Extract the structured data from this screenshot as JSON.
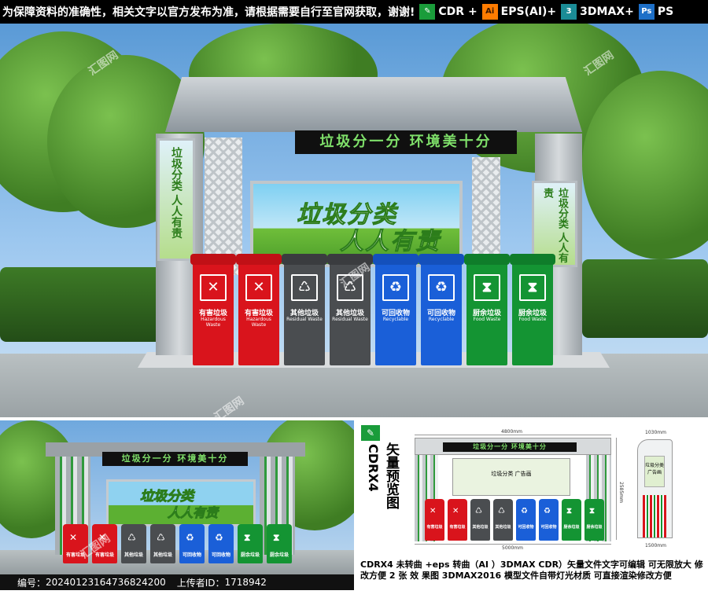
{
  "notice": "为保障资料的准确性，相关文字以官方发布为准，请根据需要自行至官网获取，谢谢!",
  "formats": [
    "CDR +",
    "EPS(AI)+",
    "3DMAX+",
    "PS"
  ],
  "format_icons": [
    "cdr-logo-icon",
    "ai-logo-icon",
    "3dmax-logo-icon",
    "ps-logo-icon"
  ],
  "sign_text": "垃圾分一分  环境美十分",
  "billboard_line1": "垃圾分类",
  "billboard_line2": "人人有责",
  "side_panel_text": "垃圾分类 人人有责",
  "bins": [
    {
      "color": "red",
      "label": "有害垃圾",
      "sub": "Hazardous Waste",
      "symbol": "✕"
    },
    {
      "color": "red",
      "label": "有害垃圾",
      "sub": "Hazardous Waste",
      "symbol": "✕"
    },
    {
      "color": "grey",
      "label": "其他垃圾",
      "sub": "Residual Waste",
      "symbol": "♺"
    },
    {
      "color": "grey",
      "label": "其他垃圾",
      "sub": "Residual Waste",
      "symbol": "♺"
    },
    {
      "color": "blue",
      "label": "可回收物",
      "sub": "Recyclable",
      "symbol": "♻"
    },
    {
      "color": "blue",
      "label": "可回收物",
      "sub": "Recyclable",
      "symbol": "♻"
    },
    {
      "color": "green",
      "label": "厨余垃圾",
      "sub": "Food Waste",
      "symbol": "⧗"
    },
    {
      "color": "green",
      "label": "厨余垃圾",
      "sub": "Food Waste",
      "symbol": "⧗"
    }
  ],
  "watermark": "汇图网",
  "preview_label": "矢量预览图",
  "preview_format": "CDRX4",
  "dims": {
    "top_width": "4800mm",
    "bottom_width": "5000mm",
    "height": "2585mm",
    "side_top": "1030mm",
    "side_bottom": "1500mm"
  },
  "drawing_board_text": "垃圾分类 广告画",
  "footer": {
    "code_label": "编号：",
    "code": "20240123164736824200",
    "uploader_label": "上传者ID：",
    "uploader": "1718942"
  },
  "description": "CDRX4 未转曲 +eps 转曲（AI  ）3DMAX CDR）矢量文件文字可编辑 可无限放大 修改方便 2 张 效 果图 3DMAX2016 模型文件自带灯光材质 可直接渲染修改方便",
  "colors": {
    "red": "#d9141c",
    "grey": "#4a4d50",
    "blue": "#1a5fd8",
    "green": "#149433",
    "sign_text": "#7fe06a"
  }
}
